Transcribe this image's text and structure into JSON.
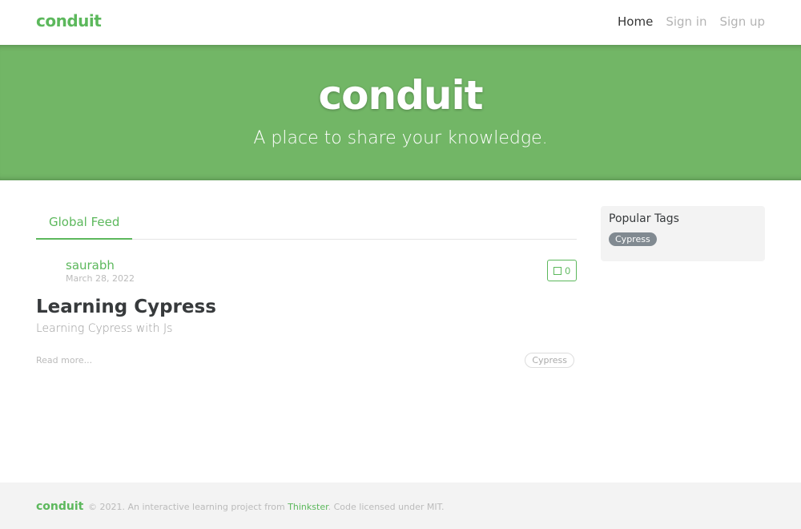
{
  "navbar": {
    "brand": "conduit",
    "links": [
      "Home",
      "Sign in",
      "Sign up"
    ]
  },
  "banner": {
    "title": "conduit",
    "subtitle": "A place to share your knowledge."
  },
  "feed": {
    "tab_label": "Global Feed",
    "article": {
      "author": "saurabh",
      "date": "March 28, 2022",
      "favorites_count": "0",
      "title": "Learning Cypress",
      "description": "Learning Cypress with Js",
      "read_more": "Read more...",
      "tags": [
        "Cypress"
      ]
    }
  },
  "sidebar": {
    "title": "Popular Tags",
    "tags": [
      "Cypress"
    ]
  },
  "footer": {
    "logo": "conduit",
    "text_before": "© 2021. An interactive learning project from ",
    "link": "Thinkster",
    "text_after": ". Code licensed under MIT."
  },
  "colors": {
    "brand": "#5cb85c",
    "banner": "#72b666",
    "tag_pill": "#818a91"
  }
}
